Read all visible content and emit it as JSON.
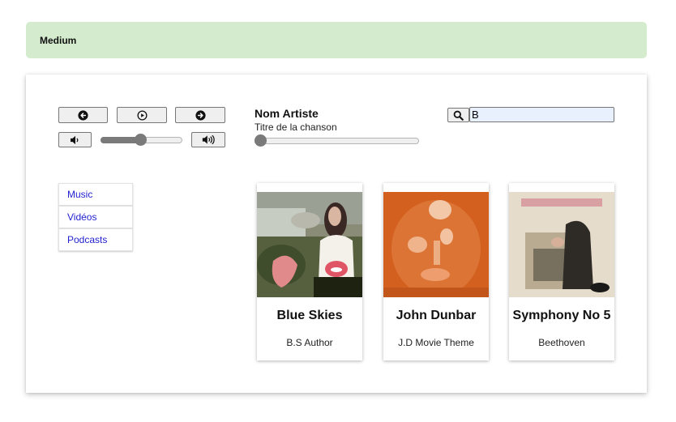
{
  "banner": {
    "label": "Medium"
  },
  "player": {
    "prev_icon": "arrow-left-circle-icon",
    "play_icon": "play-circle-icon",
    "next_icon": "arrow-right-circle-icon",
    "volume_down_icon": "volume-low-icon",
    "volume_up_icon": "volume-high-icon",
    "volume_level": 0.5,
    "progress": 0.0,
    "artist": "Nom Artiste",
    "song": "Titre de la chanson"
  },
  "search": {
    "icon": "search-icon",
    "value": "B"
  },
  "nav": {
    "items": [
      {
        "label": "Music"
      },
      {
        "label": "Vidéos"
      },
      {
        "label": "Podcasts"
      }
    ]
  },
  "albums": [
    {
      "title": "Blue Skies",
      "subtitle": "B.S Author"
    },
    {
      "title": "John Dunbar",
      "subtitle": "J.D Movie Theme"
    },
    {
      "title": "Symphony No 5",
      "subtitle": "Beethoven"
    }
  ],
  "colors": {
    "banner_bg": "#d4ebcd",
    "link": "#1f1fcf",
    "slider": "#7a7a7a"
  }
}
